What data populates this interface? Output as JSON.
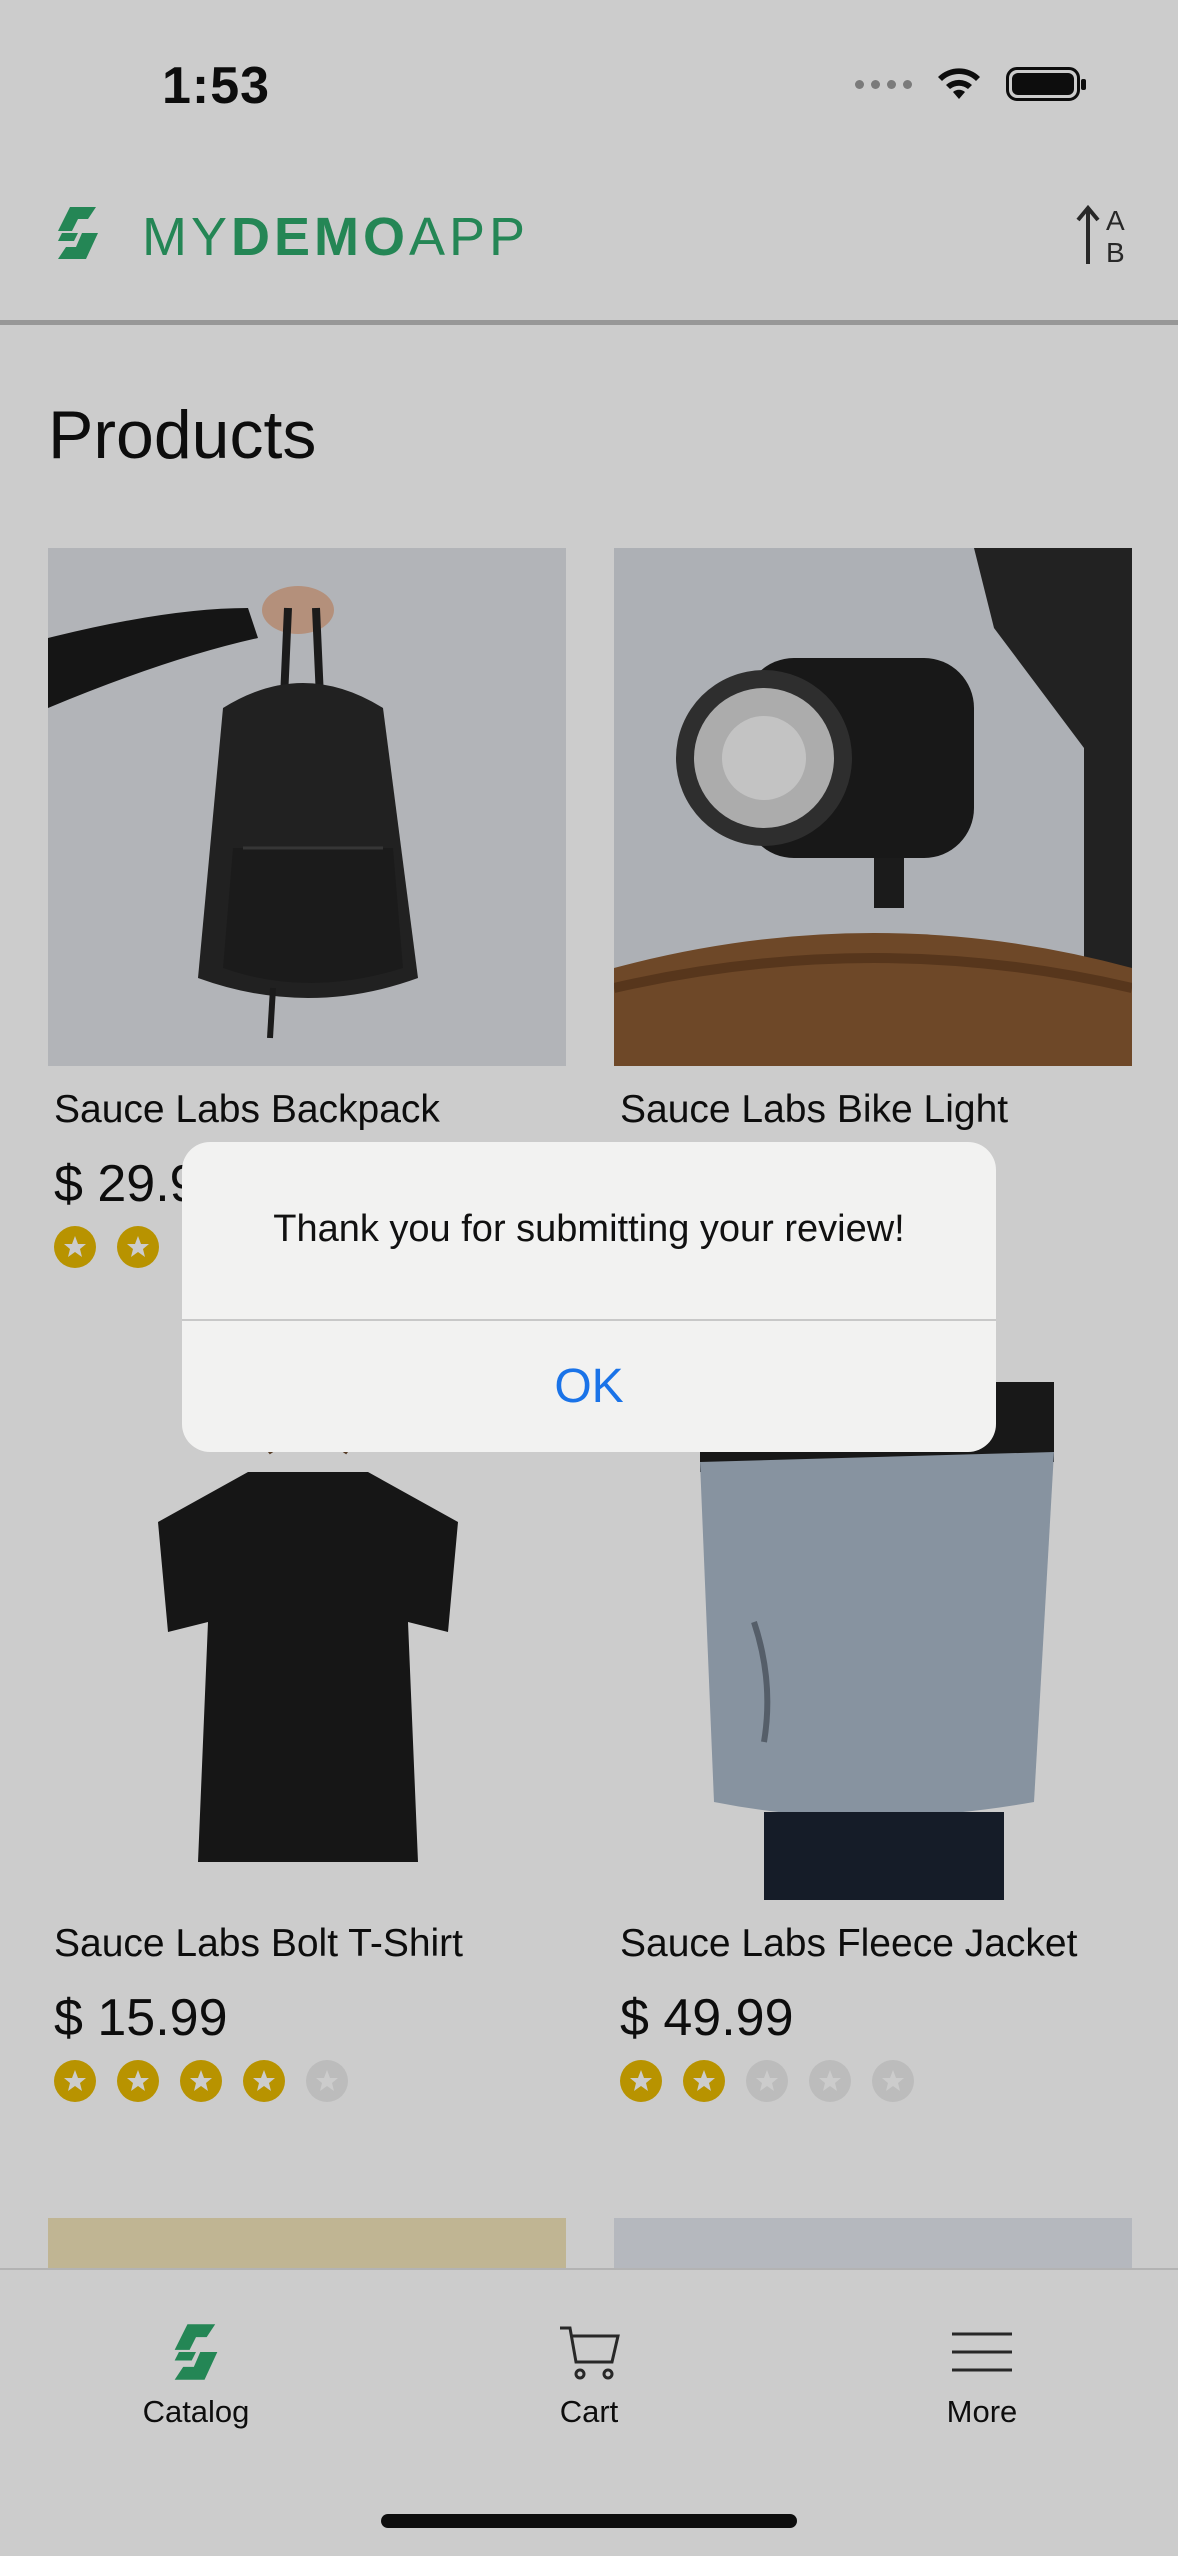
{
  "status_bar": {
    "time": "1:53"
  },
  "header": {
    "logo_part1": "MY",
    "logo_part2": "DEMO",
    "logo_part3": "APP",
    "brand_color": "#2da86b",
    "sort_icon": "sort-alpha-icon"
  },
  "page": {
    "title": "Products"
  },
  "products": [
    {
      "name": "Sauce Labs Backpack",
      "price": "$ 29.99",
      "rating": 2
    },
    {
      "name": "Sauce Labs Bike Light",
      "price": "",
      "rating": 0
    },
    {
      "name": "Sauce Labs Bolt T-Shirt",
      "price": "$ 15.99",
      "rating": 4
    },
    {
      "name": "Sauce Labs Fleece Jacket",
      "price": "$ 49.99",
      "rating": 2
    }
  ],
  "dialog": {
    "message": "Thank you for submitting your review!",
    "ok_label": "OK",
    "button_color": "#1a73e8"
  },
  "tab_bar": {
    "tabs": [
      {
        "label": "Catalog",
        "icon": "catalog-logo-icon"
      },
      {
        "label": "Cart",
        "icon": "cart-icon"
      },
      {
        "label": "More",
        "icon": "menu-icon"
      }
    ]
  },
  "star_color": "#e6b800"
}
